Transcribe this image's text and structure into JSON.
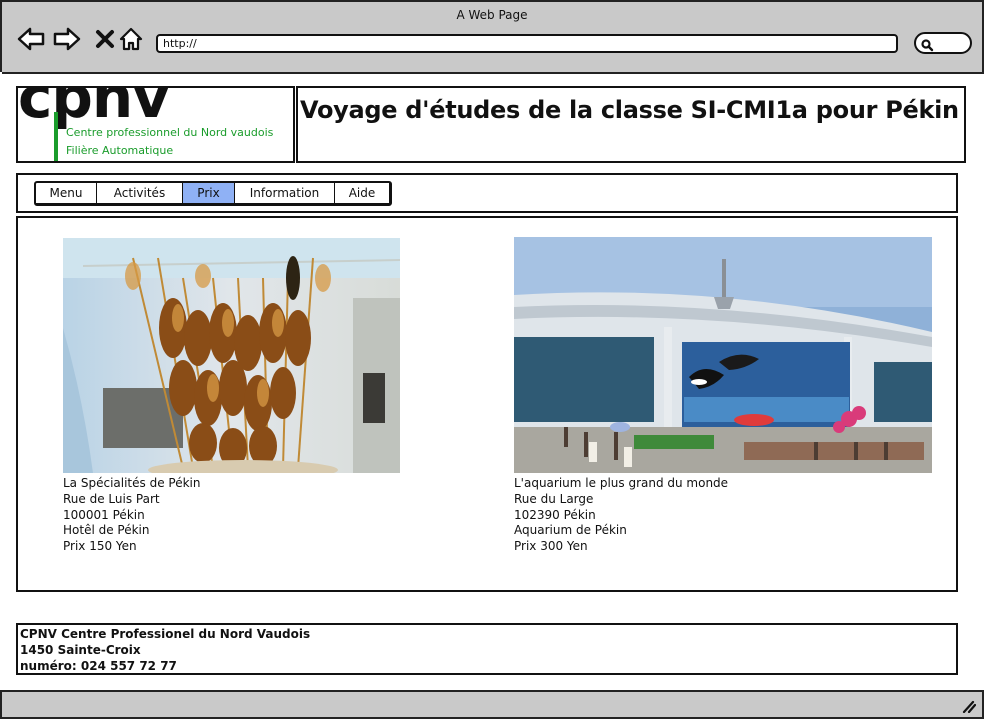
{
  "browser": {
    "window_title": "A Web Page",
    "url": "http://",
    "icons": [
      "back-arrow-icon",
      "forward-arrow-icon",
      "close-x-icon",
      "home-icon",
      "search-icon",
      "resize-grip-icon"
    ]
  },
  "header": {
    "logo": {
      "wordmark": "cpnv",
      "line1": "Centre professionnel du Nord vaudois",
      "line2": "Filière Automatique",
      "accent_color": "#1a9c2b"
    },
    "title": "Voyage d'études de la classe SI-CMI1a pour Pékin"
  },
  "nav": {
    "tabs": [
      {
        "label": "Menu",
        "active": false
      },
      {
        "label": "Activités",
        "active": false
      },
      {
        "label": "Prix",
        "active": true
      },
      {
        "label": "Information",
        "active": false
      },
      {
        "label": "Aide",
        "active": false
      }
    ],
    "active_color": "#8fb1f5"
  },
  "main": {
    "items": [
      {
        "image_subject": "fried scorpions on skewers",
        "lines": [
          "La Spécialités de Pékin",
          "Rue de Luis Part",
          "100001 Pékin",
          "Hotêl de Pékin",
          "Prix 150 Yen"
        ]
      },
      {
        "image_subject": "aquarium building facade",
        "lines": [
          "L'aquarium le plus grand du monde",
          "Rue du Large",
          "102390 Pékin",
          "Aquarium de Pékin",
          "Prix 300 Yen"
        ]
      }
    ]
  },
  "footer": {
    "lines": [
      "CPNV Centre Professionel du Nord Vaudois",
      "1450 Sainte-Croix",
      "numéro: 024 557 72 77"
    ]
  }
}
